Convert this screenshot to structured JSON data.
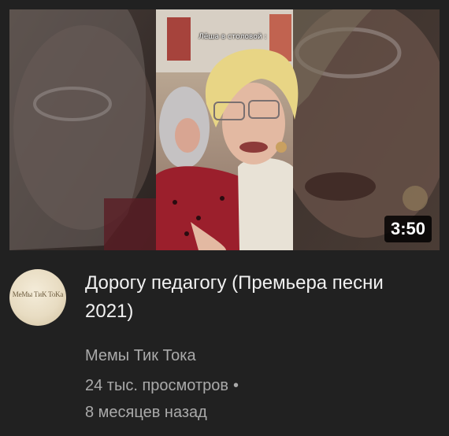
{
  "video": {
    "title": "Дорогу педагогу (Премьера песни 2021)",
    "duration": "3:50",
    "overlay_caption": "Лёша в столовой :"
  },
  "channel": {
    "name": "Мемы Тик Тока",
    "avatar_text": "MeMы TиK ToKa"
  },
  "stats": {
    "views": "24 тыс. просмотров",
    "separator": "•",
    "age": "8 месяцев назад"
  }
}
